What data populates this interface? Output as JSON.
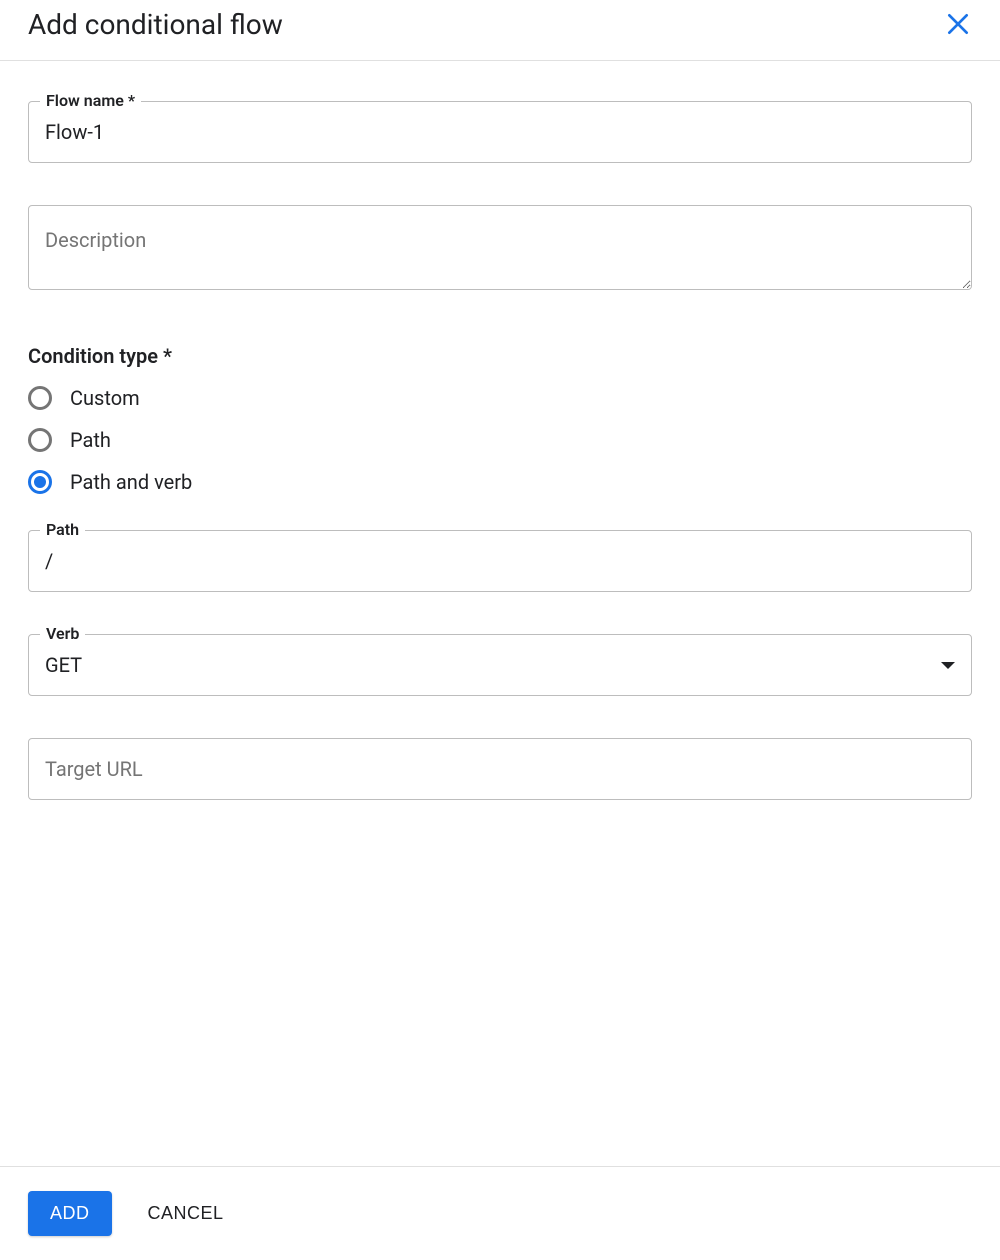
{
  "header": {
    "title": "Add conditional flow"
  },
  "form": {
    "flowName": {
      "label": "Flow name *",
      "value": "Flow-1"
    },
    "description": {
      "placeholder": "Description",
      "value": ""
    },
    "conditionType": {
      "label": "Condition type *",
      "options": {
        "custom": "Custom",
        "path": "Path",
        "pathAndVerb": "Path and verb"
      },
      "selected": "pathAndVerb"
    },
    "path": {
      "label": "Path",
      "value": "/"
    },
    "verb": {
      "label": "Verb",
      "value": "GET"
    },
    "targetUrl": {
      "placeholder": "Target URL",
      "value": ""
    }
  },
  "footer": {
    "add": "ADD",
    "cancel": "CANCEL"
  }
}
